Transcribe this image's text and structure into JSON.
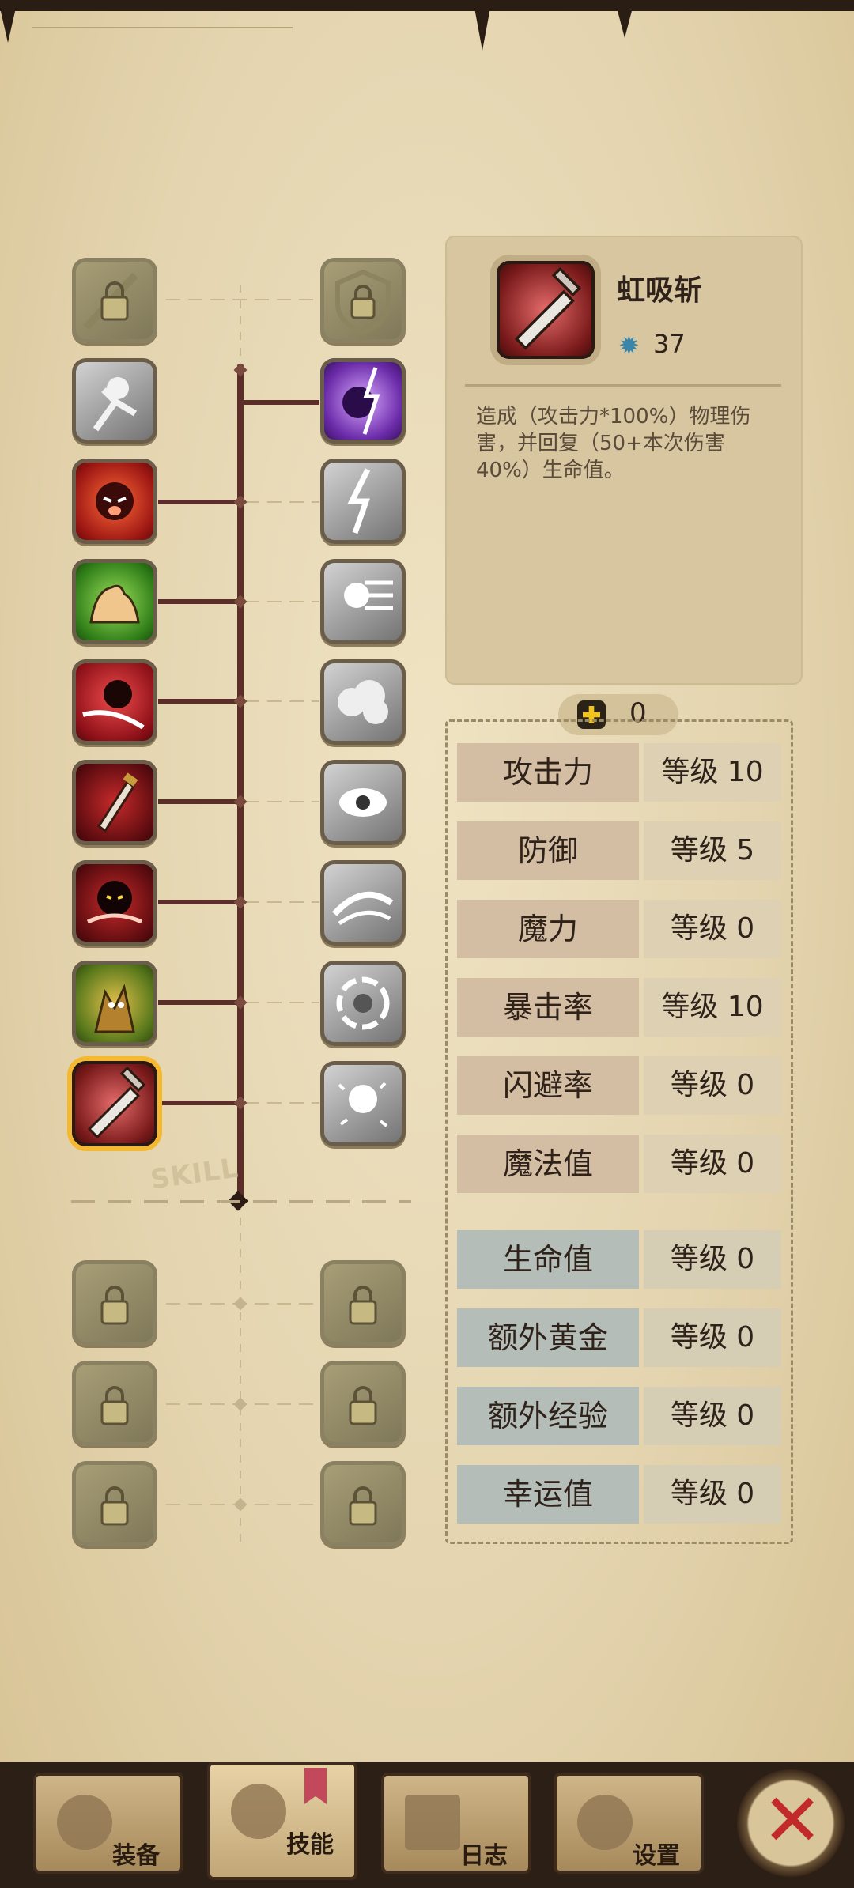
{
  "skill_tree": {
    "watermark": "SKILL",
    "left_column": [
      {
        "id": "sword-lock",
        "state": "locked"
      },
      {
        "id": "throw",
        "state": "inactive"
      },
      {
        "id": "rage",
        "state": "learned"
      },
      {
        "id": "strength",
        "state": "learned"
      },
      {
        "id": "dash",
        "state": "learned"
      },
      {
        "id": "dagger",
        "state": "learned"
      },
      {
        "id": "shadow",
        "state": "learned"
      },
      {
        "id": "forest",
        "state": "learned"
      },
      {
        "id": "rainbow-slash",
        "state": "selected"
      }
    ],
    "right_column": [
      {
        "id": "shield-lock",
        "state": "locked"
      },
      {
        "id": "lightning-mage",
        "state": "learned"
      },
      {
        "id": "thunder",
        "state": "inactive"
      },
      {
        "id": "charge",
        "state": "inactive"
      },
      {
        "id": "cloud",
        "state": "inactive"
      },
      {
        "id": "eye",
        "state": "inactive"
      },
      {
        "id": "wind-blade",
        "state": "inactive"
      },
      {
        "id": "vortex",
        "state": "inactive"
      },
      {
        "id": "sparkle",
        "state": "inactive"
      }
    ],
    "lower_locked": 6
  },
  "selected_skill": {
    "name": "虹吸斩",
    "cost": "37",
    "description": "造成（攻击力*100%）物理伤害，并回复（50+本次伤害40%）生命值。"
  },
  "skill_points": "0",
  "stats": [
    {
      "name": "攻击力",
      "level": "等级 10",
      "kind": "attr"
    },
    {
      "name": "防御",
      "level": "等级 5",
      "kind": "attr"
    },
    {
      "name": "魔力",
      "level": "等级 0",
      "kind": "attr"
    },
    {
      "name": "暴击率",
      "level": "等级 10",
      "kind": "attr"
    },
    {
      "name": "闪避率",
      "level": "等级 0",
      "kind": "attr"
    },
    {
      "name": "魔法值",
      "level": "等级 0",
      "kind": "attr"
    },
    {
      "name": "生命值",
      "level": "等级 0",
      "kind": "bonus"
    },
    {
      "name": "额外黄金",
      "level": "等级 0",
      "kind": "bonus"
    },
    {
      "name": "额外经验",
      "level": "等级 0",
      "kind": "bonus"
    },
    {
      "name": "幸运值",
      "level": "等级 0",
      "kind": "bonus"
    }
  ],
  "nav": {
    "equip": "装备",
    "skills": "技能",
    "log": "日志",
    "settings": "设置",
    "active": "skills",
    "close_icon": "close-icon"
  },
  "colors": {
    "parchment": "#e6d8b6",
    "trunk": "#5b2e2a",
    "selected_border": "#f4b930",
    "plus_yellow": "#f3c51c",
    "close_red": "#c22a2a"
  }
}
